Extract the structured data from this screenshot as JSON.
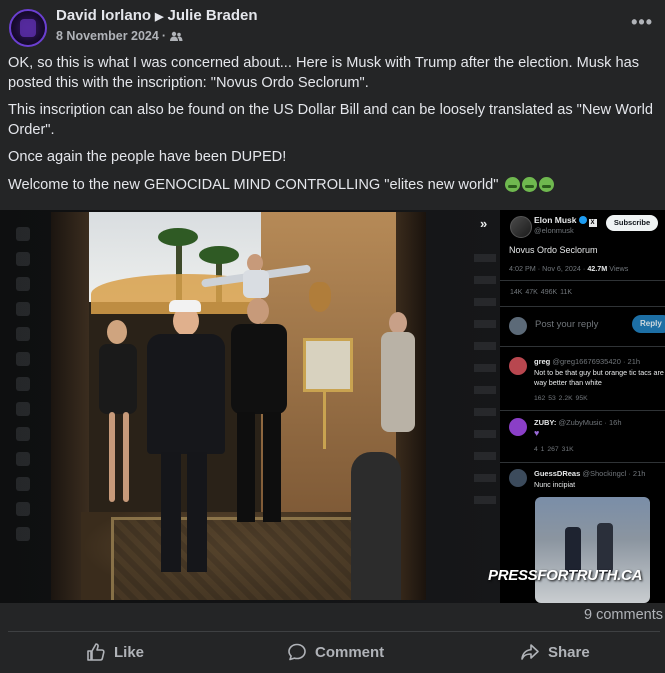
{
  "post": {
    "author": "David Iorlano",
    "recipient": "Julie Braden",
    "date": "8 November 2024",
    "more_icon": "more-horizontal-icon",
    "paragraphs": [
      "OK, so this is what I was concerned about...  Here is Musk with Trump after the election. Musk has posted this with the inscription: \"Novus Ordo Seclorum\".",
      "This inscription can also be found on the US Dollar Bill and can be loosely translated as \"New World Order\".",
      "Once again the people have been DUPED!",
      "Welcome to the new GENOCIDAL MIND CONTROLLING \"elites new world\""
    ]
  },
  "embedded_x_post": {
    "author_name": "Elon Musk",
    "author_handle": "@elonmusk",
    "subscribe_label": "Subscribe",
    "text": "Novus Ordo Seclorum",
    "time": "4:02 PM · Nov 6, 2024 ·",
    "views_count": "42.7M",
    "views_label": "Views",
    "stats": "14K   47K   496K   11K",
    "reply_placeholder": "Post your reply",
    "reply_button": "Reply",
    "comments": [
      {
        "name": "greg",
        "handle": "@greg16676935420 · 21h",
        "text": "Not to be that guy but orange tic tacs are way better than white",
        "stats": "162   53   2.2K   95K",
        "avatar_color": "#b8474f"
      },
      {
        "name": "ZUBY:",
        "handle": "@ZubyMusic · 16h",
        "text": "",
        "stats": "4   1   267   31K",
        "avatar_color": "#8a3fc7"
      },
      {
        "name": "GuessDReas",
        "handle": "@Shockingcl · 21h",
        "text": "Nunc incipiat",
        "stats": "",
        "avatar_color": "#3c4b5c"
      }
    ]
  },
  "watermark": "PRESSFORTRUTH.CA",
  "footer": {
    "comments_count": "9 comments",
    "like_label": "Like",
    "comment_label": "Comment",
    "share_label": "Share"
  }
}
